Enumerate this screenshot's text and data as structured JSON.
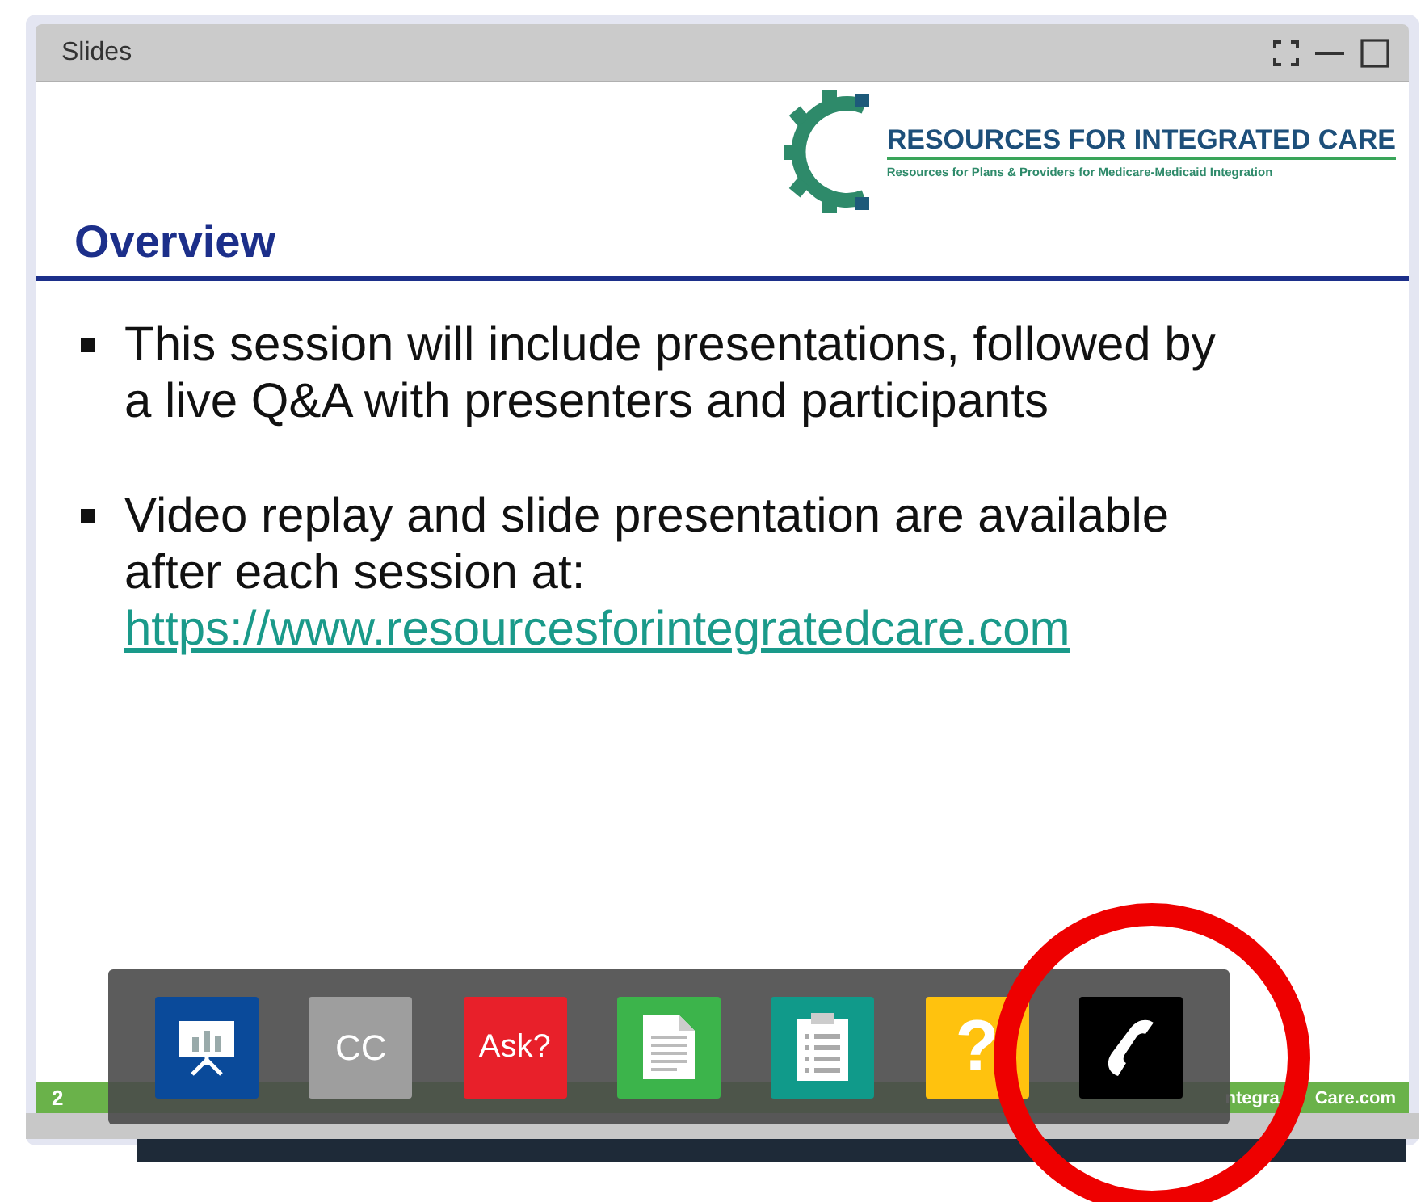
{
  "window": {
    "title": "Slides"
  },
  "window_controls": [
    {
      "kind": "fullscreen"
    },
    {
      "kind": "minimize"
    },
    {
      "kind": "maximize"
    }
  ],
  "slide": {
    "logo": {
      "title": "RESOURCES FOR INTEGRATED CARE",
      "subtitle": "Resources for Plans & Providers for Medicare-Medicaid Integration"
    },
    "heading": "Overview",
    "bullets": [
      {
        "lines": [
          "This session will include presentations, followed by",
          "a live Q&A with presenters and participants"
        ]
      },
      {
        "lines": [
          "Video replay and slide presentation are available",
          "after each session at:"
        ],
        "link": "https://www.resourcesforintegratedcare.com"
      }
    ],
    "footer": {
      "page": "2",
      "url_parts": [
        "ntegra",
        "Care.com"
      ]
    }
  },
  "toolbar": [
    {
      "kind": "presentation",
      "color": "#0a4a9a"
    },
    {
      "kind": "text",
      "label": "CC",
      "color": "#9e9e9e"
    },
    {
      "kind": "text",
      "label": "Ask?",
      "color": "#e8202a"
    },
    {
      "kind": "document",
      "color": "#3cb44b"
    },
    {
      "kind": "clipboard",
      "color": "#109a8a"
    },
    {
      "kind": "text",
      "label": "?",
      "color": "#ffc20e"
    },
    {
      "kind": "phone",
      "color": "#000000"
    }
  ],
  "annotation": {
    "kind": "circle",
    "color": "#ee0000"
  }
}
